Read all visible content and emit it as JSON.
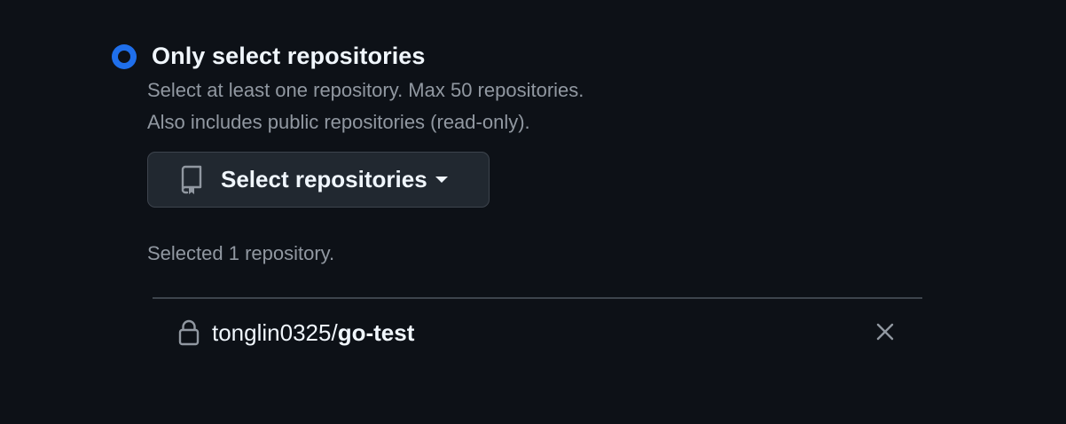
{
  "access": {
    "option_label": "Only select repositories",
    "description_line1": "Select at least one repository. Max 50 repositories.",
    "description_line2": "Also includes public repositories (read-only).",
    "selected": true
  },
  "select_button": {
    "label": "Select repositories",
    "icon": "repo-icon",
    "caret_icon": "triangle-down-icon"
  },
  "selection": {
    "count_text": "Selected 1 repository.",
    "repositories": [
      {
        "owner": "tonglin0325",
        "separator": "/",
        "name": "go-test",
        "icon": "lock-icon",
        "remove_icon": "close-icon"
      }
    ]
  },
  "colors": {
    "background": "#0d1117",
    "accent": "#1f6feb",
    "muted_text": "#9198a1",
    "button_bg": "#212830",
    "border": "#3d444d"
  }
}
